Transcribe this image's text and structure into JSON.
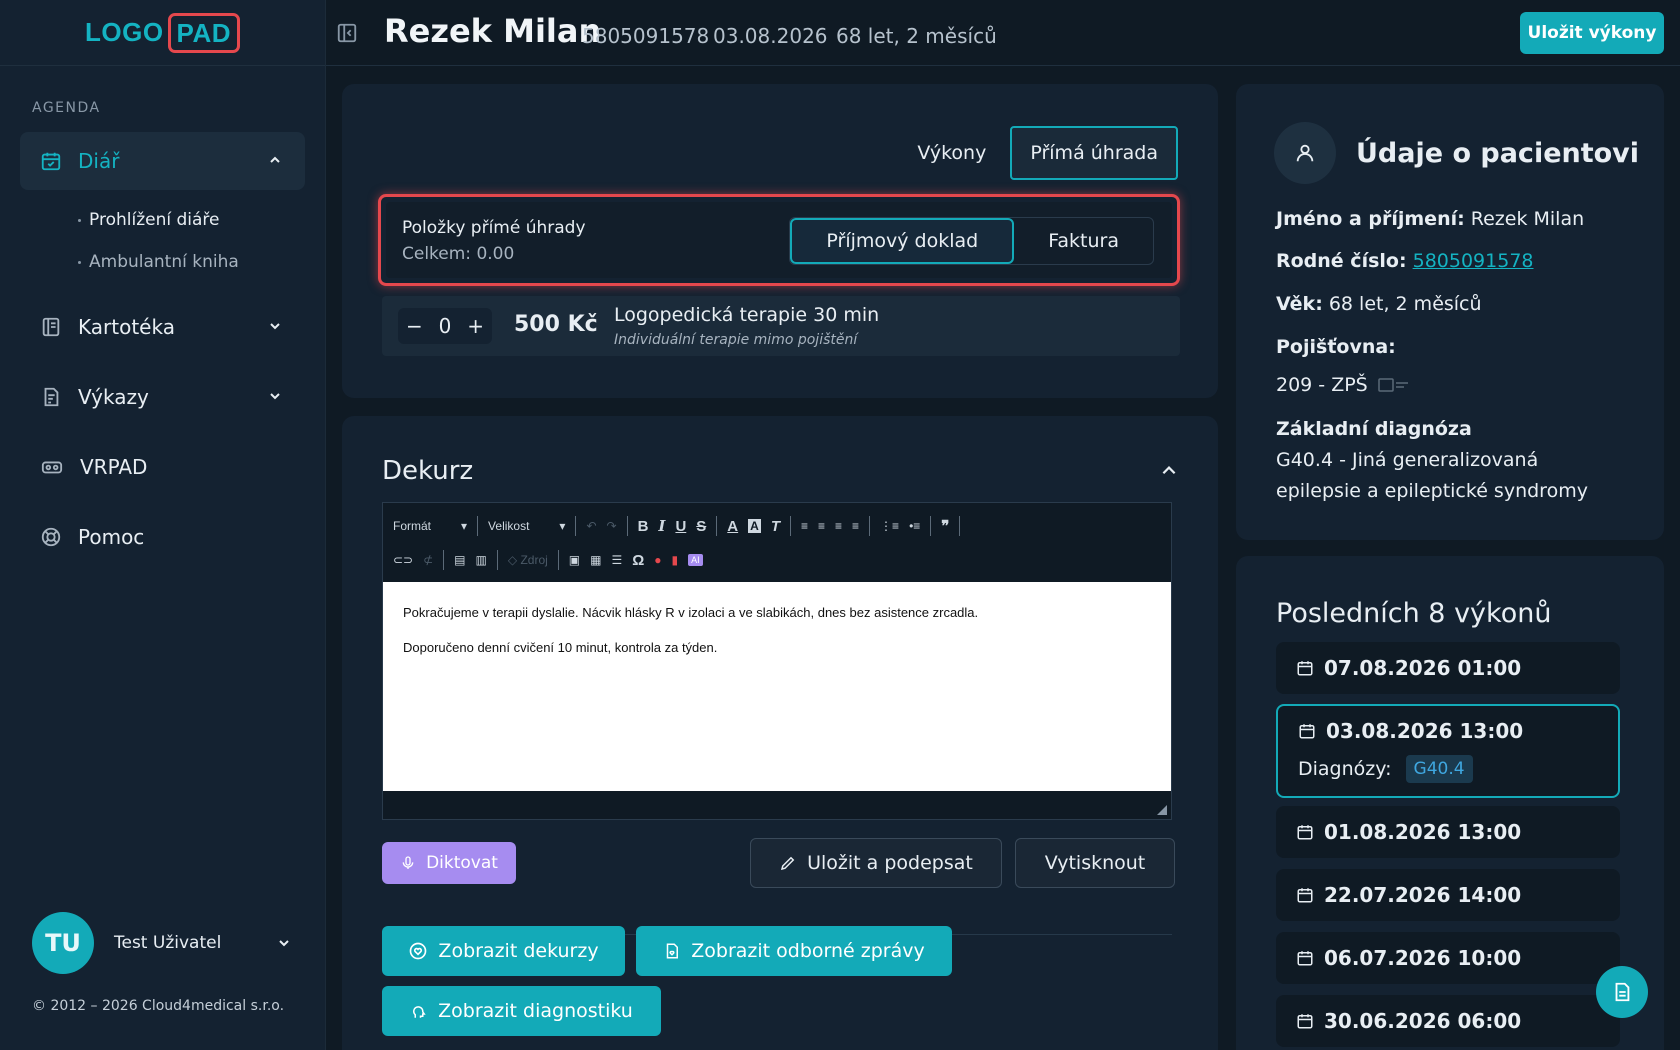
{
  "logo": {
    "part1": "LOGO",
    "part2": "PAD"
  },
  "sidebar": {
    "section_label": "AGENDA",
    "items": [
      {
        "label": "Diář"
      },
      {
        "label": "Kartotéka"
      },
      {
        "label": "Výkazy"
      },
      {
        "label": "VRPAD"
      },
      {
        "label": "Pomoc"
      }
    ],
    "sub_items": [
      {
        "label": "Prohlížení diáře"
      },
      {
        "label": "Ambulantní kniha"
      }
    ],
    "user": {
      "initials": "TU",
      "name": "Test Uživatel"
    },
    "copyright": "© 2012 – 2026 Cloud4medical s.r.o."
  },
  "header": {
    "patient_name": "Rezek Milan",
    "birth_number": "5805091578",
    "date": "03.08.2026",
    "age": "68 let, 2 měsíců",
    "save_label": "Uložit výkony"
  },
  "payment": {
    "tabs": [
      "Výkony",
      "Přímá úhrada"
    ],
    "items_title": "Položky přímé úhrady",
    "items_total": "Celkem: 0.00",
    "doc_types": [
      "Příjmový doklad",
      "Faktura"
    ],
    "service": {
      "qty": "0",
      "price": "500 Kč",
      "name": "Logopedická terapie 30 min",
      "description": "Individuální terapie mimo pojištění"
    }
  },
  "dekurz": {
    "title": "Dekurz",
    "toolbar": {
      "format": "Formát",
      "size": "Velikost",
      "source": "Zdroj"
    },
    "text": [
      "Pokračujeme v terapii dyslalie. Nácvik hlásky R v izolaci a ve slabikách, dnes bez asistence zrcadla.",
      "Doporučeno denní cvičení 10 minut, kontrola za týden."
    ],
    "dictate_label": "Diktovat",
    "save_sign_label": "Uložit a podepsat",
    "print_label": "Vytisknout",
    "show_dekurzy": "Zobrazit dekurzy",
    "show_reports": "Zobrazit odborné zprávy",
    "show_diagnostics": "Zobrazit diagnostiku"
  },
  "patient_info": {
    "title": "Údaje o pacientovi",
    "name_label": "Jméno a příjmení:",
    "name_value": "Rezek Milan",
    "rc_label": "Rodné číslo:",
    "rc_value": "5805091578",
    "age_label": "Věk:",
    "age_value": "68 let, 2 měsíců",
    "insurance_label": "Pojišťovna:",
    "insurance_value": "209 - ZPŠ",
    "diagnosis_label": "Základní diagnóza",
    "diagnosis_line1": "G40.4 - Jiná generalizovaná",
    "diagnosis_line2": "epilepsie a epileptické syndromy"
  },
  "visits": {
    "title": "Posledních 8 výkonů",
    "items": [
      {
        "date": "07.08.2026 01:00"
      },
      {
        "date": "03.08.2026 13:00",
        "diag_label": "Diagnózy:",
        "diag": "G40.4"
      },
      {
        "date": "01.08.2026 13:00"
      },
      {
        "date": "22.07.2026 14:00"
      },
      {
        "date": "06.07.2026 10:00"
      },
      {
        "date": "30.06.2026 06:00"
      }
    ]
  },
  "colors": {
    "accent": "#13aab8",
    "highlight": "#e5484d",
    "purple": "#a68cf0"
  }
}
